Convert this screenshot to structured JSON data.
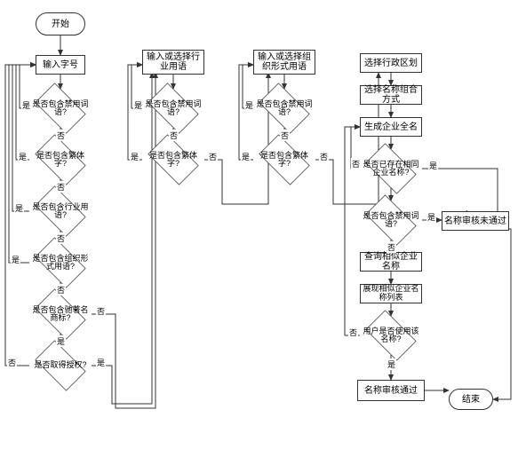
{
  "start": "开始",
  "end": "结束",
  "col1": {
    "input": "输入字号",
    "d1": "是否包含禁用词语?",
    "d2": "是否包含繁体字?",
    "d3": "是否包含行业用语?",
    "d4": "是否包含组织形式用语?",
    "d5": "是否包含驰著名商标?",
    "d6": "是否取得授权?"
  },
  "col2": {
    "input": "输入或选择行业用语",
    "d1": "是否包含禁用词语?",
    "d2": "是否包含繁体字?"
  },
  "col3": {
    "input": "输入或选择组织形式用语",
    "d1": "是否包含禁用词语?",
    "d2": "是否包含繁体字?"
  },
  "col4": {
    "p1": "选择行政区划",
    "p2": "选择名称组合方式",
    "p3": "生成企业全名",
    "d1": "是否已存在相同企业名称?",
    "d2": "是否包含禁用词语?",
    "p4": "查询相似企业名称",
    "p5": "展现相似企业名称列表",
    "d3": "用户是否使用该名称?",
    "pass": "名称审核通过"
  },
  "fail": "名称审核未通过",
  "labels": {
    "yes": "是",
    "no": "否"
  },
  "chart_data": {
    "type": "flowchart",
    "title": "企业名称审核流程",
    "nodes": [
      {
        "id": "start",
        "type": "terminator",
        "label": "开始"
      },
      {
        "id": "c1p",
        "type": "process",
        "label": "输入字号"
      },
      {
        "id": "c1d1",
        "type": "decision",
        "label": "是否包含禁用词语?"
      },
      {
        "id": "c1d2",
        "type": "decision",
        "label": "是否包含繁体字?"
      },
      {
        "id": "c1d3",
        "type": "decision",
        "label": "是否包含行业用语?"
      },
      {
        "id": "c1d4",
        "type": "decision",
        "label": "是否包含组织形式用语?"
      },
      {
        "id": "c1d5",
        "type": "decision",
        "label": "是否包含驰著名商标?"
      },
      {
        "id": "c1d6",
        "type": "decision",
        "label": "是否取得授权?"
      },
      {
        "id": "c2p",
        "type": "process",
        "label": "输入或选择行业用语"
      },
      {
        "id": "c2d1",
        "type": "decision",
        "label": "是否包含禁用词语?"
      },
      {
        "id": "c2d2",
        "type": "decision",
        "label": "是否包含繁体字?"
      },
      {
        "id": "c3p",
        "type": "process",
        "label": "输入或选择组织形式用语"
      },
      {
        "id": "c3d1",
        "type": "decision",
        "label": "是否包含禁用词语?"
      },
      {
        "id": "c3d2",
        "type": "decision",
        "label": "是否包含繁体字?"
      },
      {
        "id": "c4p1",
        "type": "process",
        "label": "选择行政区划"
      },
      {
        "id": "c4p2",
        "type": "process",
        "label": "选择名称组合方式"
      },
      {
        "id": "c4p3",
        "type": "process",
        "label": "生成企业全名"
      },
      {
        "id": "c4d1",
        "type": "decision",
        "label": "是否已存在相同企业名称?"
      },
      {
        "id": "c4d2",
        "type": "decision",
        "label": "是否包含禁用词语?"
      },
      {
        "id": "c4p4",
        "type": "process",
        "label": "查询相似企业名称"
      },
      {
        "id": "c4p5",
        "type": "process",
        "label": "展现相似企业名称列表"
      },
      {
        "id": "c4d3",
        "type": "decision",
        "label": "用户是否使用该名称?"
      },
      {
        "id": "pass",
        "type": "process",
        "label": "名称审核通过"
      },
      {
        "id": "fail",
        "type": "process",
        "label": "名称审核未通过"
      },
      {
        "id": "end",
        "type": "terminator",
        "label": "结束"
      }
    ],
    "edges": [
      {
        "from": "start",
        "to": "c1p"
      },
      {
        "from": "c1p",
        "to": "c1d1"
      },
      {
        "from": "c1d1",
        "to": "c1p",
        "label": "是"
      },
      {
        "from": "c1d1",
        "to": "c1d2",
        "label": "否"
      },
      {
        "from": "c1d2",
        "to": "c1p",
        "label": "是"
      },
      {
        "from": "c1d2",
        "to": "c1d3",
        "label": "否"
      },
      {
        "from": "c1d3",
        "to": "c1p",
        "label": "是"
      },
      {
        "from": "c1d3",
        "to": "c1d4",
        "label": "否"
      },
      {
        "from": "c1d4",
        "to": "c1p",
        "label": "是"
      },
      {
        "from": "c1d4",
        "to": "c1d5",
        "label": "否"
      },
      {
        "from": "c1d5",
        "to": "c1d6",
        "label": "是"
      },
      {
        "from": "c1d5",
        "to": "c2p",
        "label": "否"
      },
      {
        "from": "c1d6",
        "to": "c1p",
        "label": "否"
      },
      {
        "from": "c1d6",
        "to": "c2p",
        "label": "是"
      },
      {
        "from": "c2p",
        "to": "c2d1"
      },
      {
        "from": "c2d1",
        "to": "c2p",
        "label": "是"
      },
      {
        "from": "c2d1",
        "to": "c2d2",
        "label": "否"
      },
      {
        "from": "c2d2",
        "to": "c2p",
        "label": "是"
      },
      {
        "from": "c2d2",
        "to": "c3p",
        "label": "否"
      },
      {
        "from": "c3p",
        "to": "c3d1"
      },
      {
        "from": "c3d1",
        "to": "c3p",
        "label": "是"
      },
      {
        "from": "c3d1",
        "to": "c3d2",
        "label": "否"
      },
      {
        "from": "c3d2",
        "to": "c3p",
        "label": "是"
      },
      {
        "from": "c3d2",
        "to": "c4p1",
        "label": "否"
      },
      {
        "from": "c4p1",
        "to": "c4p2"
      },
      {
        "from": "c4p2",
        "to": "c4p3"
      },
      {
        "from": "c4p3",
        "to": "c4d1"
      },
      {
        "from": "c4d1",
        "to": "c4d2",
        "label": "否"
      },
      {
        "from": "c4d1",
        "to": "fail",
        "label": "是"
      },
      {
        "from": "c4d2",
        "to": "c4p4",
        "label": "否"
      },
      {
        "from": "c4d2",
        "to": "fail",
        "label": "是"
      },
      {
        "from": "c4p4",
        "to": "c4p5"
      },
      {
        "from": "c4p5",
        "to": "c4d3"
      },
      {
        "from": "c4d3",
        "to": "pass",
        "label": "是"
      },
      {
        "from": "c4d3",
        "to": "c4p3",
        "label": "否"
      },
      {
        "from": "pass",
        "to": "end"
      },
      {
        "from": "fail",
        "to": "end"
      }
    ]
  }
}
